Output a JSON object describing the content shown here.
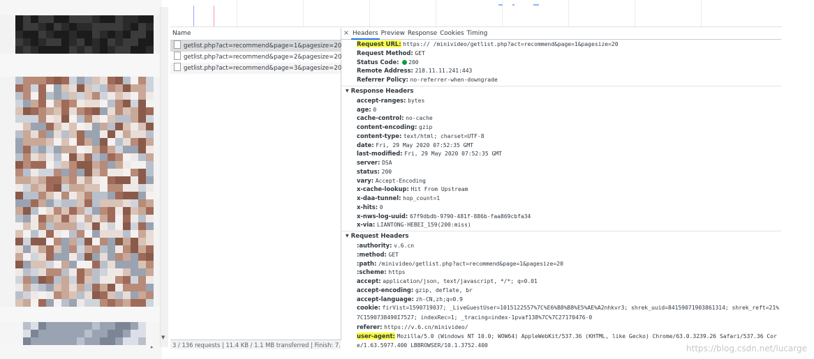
{
  "request_list": {
    "header": "Name",
    "rows": [
      "getlist.php?act=recommend&page=1&pagesize=20",
      "getlist.php?act=recommend&page=2&pagesize=20",
      "getlist.php?act=recommend&page=3&pagesize=20"
    ],
    "status_bar": "3 / 136 requests | 11.4 KB / 1.1 MB transferred | Finish: 7..."
  },
  "tabs": {
    "close": "×",
    "items": [
      "Headers",
      "Preview",
      "Response",
      "Cookies",
      "Timing"
    ],
    "active": "Headers"
  },
  "general": {
    "request_url": {
      "k": "Request URL:",
      "v": "https://      /minivideo/getlist.php?act=recommend&page=1&pagesize=20"
    },
    "request_method": {
      "k": "Request Method:",
      "v": "GET"
    },
    "status_code": {
      "k": "Status Code:",
      "v": "200"
    },
    "remote_address": {
      "k": "Remote Address:",
      "v": "218.11.11.241:443"
    },
    "referrer_policy": {
      "k": "Referrer Policy:",
      "v": "no-referrer-when-downgrade"
    }
  },
  "response_headers": {
    "title": "Response Headers",
    "items": [
      {
        "k": "accept-ranges:",
        "v": "bytes"
      },
      {
        "k": "age:",
        "v": "0"
      },
      {
        "k": "cache-control:",
        "v": "no-cache"
      },
      {
        "k": "content-encoding:",
        "v": "gzip"
      },
      {
        "k": "content-type:",
        "v": "text/html; charset=UTF-8"
      },
      {
        "k": "date:",
        "v": "Fri, 29 May 2020 07:52:35 GMT"
      },
      {
        "k": "last-modified:",
        "v": "Fri, 29 May 2020 07:52:35 GMT"
      },
      {
        "k": "server:",
        "v": "DSA"
      },
      {
        "k": "status:",
        "v": "200"
      },
      {
        "k": "vary:",
        "v": "Accept-Encoding"
      },
      {
        "k": "x-cache-lookup:",
        "v": "Hit From Upstream"
      },
      {
        "k": "x-daa-tunnel:",
        "v": "hop_count=1"
      },
      {
        "k": "x-hits:",
        "v": "0"
      },
      {
        "k": "x-nws-log-uuid:",
        "v": "67f9dbdb-9790-481f-886b-faa869cbfa34"
      },
      {
        "k": "x-via:",
        "v": "LIANTONG-HEBEI_159(200:miss)"
      }
    ]
  },
  "request_headers": {
    "title": "Request Headers",
    "items": [
      {
        "k": ":authority:",
        "v": "v.6.cn"
      },
      {
        "k": ":method:",
        "v": "GET"
      },
      {
        "k": ":path:",
        "v": "/minivideo/getlist.php?act=recommend&page=1&pagesize=20"
      },
      {
        "k": ":scheme:",
        "v": "https"
      },
      {
        "k": "accept:",
        "v": "application/json, text/javascript, */*; q=0.01"
      },
      {
        "k": "accept-encoding:",
        "v": "gzip, deflate, br"
      },
      {
        "k": "accept-language:",
        "v": "zh-CN,zh;q=0.9"
      },
      {
        "k": "cookie:",
        "v": "firVist=1590719037; _LiveGuestUser=1015122557%7C%E6%B8%B8%E5%AE%A2nhkvr3; shrek_uuid=84159071903861314; shrek_reft=21%7C1590738490I7527; indexRec=1; _tracing=index-1pvaf138%7C%7C27170476-0"
      },
      {
        "k": "referer:",
        "v": "https://v.6.cn/minivideo/"
      },
      {
        "k": "user-agent:",
        "v": "Mozilla/5.0 (Windows NT 10.0; WOW64) AppleWebKit/537.36 (KHTML, like Gecko) Chrome/63.0.3239.26 Safari/537.36 Core/1.63.5977.400 LBBROWSER/10.1.3752.400"
      }
    ]
  },
  "watermark": "https://blog.csdn.net/lucarge",
  "colors": {
    "highlight": "#ffff3a",
    "active_tab": "#1a73e8",
    "status_ok": "#0a9e3f"
  }
}
